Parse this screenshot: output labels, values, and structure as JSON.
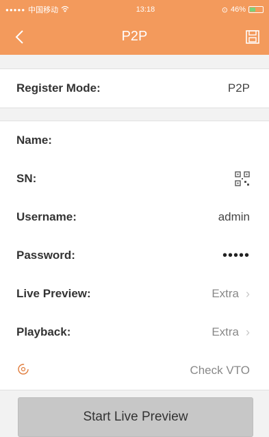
{
  "status_bar": {
    "carrier": "中国移动",
    "time": "13:18",
    "battery": "46%"
  },
  "nav": {
    "title": "P2P"
  },
  "register": {
    "label": "Register Mode:",
    "value": "P2P"
  },
  "fields": {
    "name": {
      "label": "Name:",
      "value": ""
    },
    "sn": {
      "label": "SN:"
    },
    "username": {
      "label": "Username:",
      "value": "admin"
    },
    "password": {
      "label": "Password:",
      "value": "•••••"
    },
    "live_preview": {
      "label": "Live Preview:",
      "value": "Extra"
    },
    "playback": {
      "label": "Playback:",
      "value": "Extra"
    },
    "check_vto": {
      "label": "Check VTO"
    }
  },
  "actions": {
    "start_live_preview": "Start Live Preview"
  },
  "colors": {
    "accent": "#f39a5c",
    "button_bg": "#c7c7c7"
  }
}
